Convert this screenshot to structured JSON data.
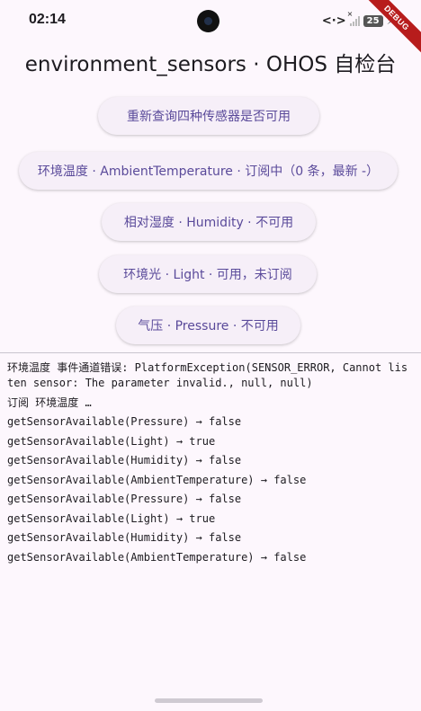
{
  "status_bar": {
    "time": "02:14",
    "battery": "25",
    "code_glyph": "<·>",
    "bolt_glyph": "⚡"
  },
  "debug_banner": "DEBUG",
  "title": "environment_sensors · OHOS 自检台",
  "buttons": {
    "requery": "重新查询四种传感器是否可用",
    "ambient_temperature": "环境温度 · AmbientTemperature · 订阅中（0 条，最新 -）",
    "humidity": "相对湿度 · Humidity · 不可用",
    "light": "环境光 · Light · 可用，未订阅",
    "pressure": "气压 · Pressure · 不可用"
  },
  "log": [
    "环境温度 事件通道错误: PlatformException(SENSOR_ERROR, Cannot listen sensor: The parameter invalid., null, null)",
    "订阅 环境温度 …",
    "getSensorAvailable(Pressure) → false",
    "getSensorAvailable(Light) → true",
    "getSensorAvailable(Humidity) → false",
    "getSensorAvailable(AmbientTemperature) → false",
    "getSensorAvailable(Pressure) → false",
    "getSensorAvailable(Light) → true",
    "getSensorAvailable(Humidity) → false",
    "getSensorAvailable(AmbientTemperature) → false"
  ]
}
